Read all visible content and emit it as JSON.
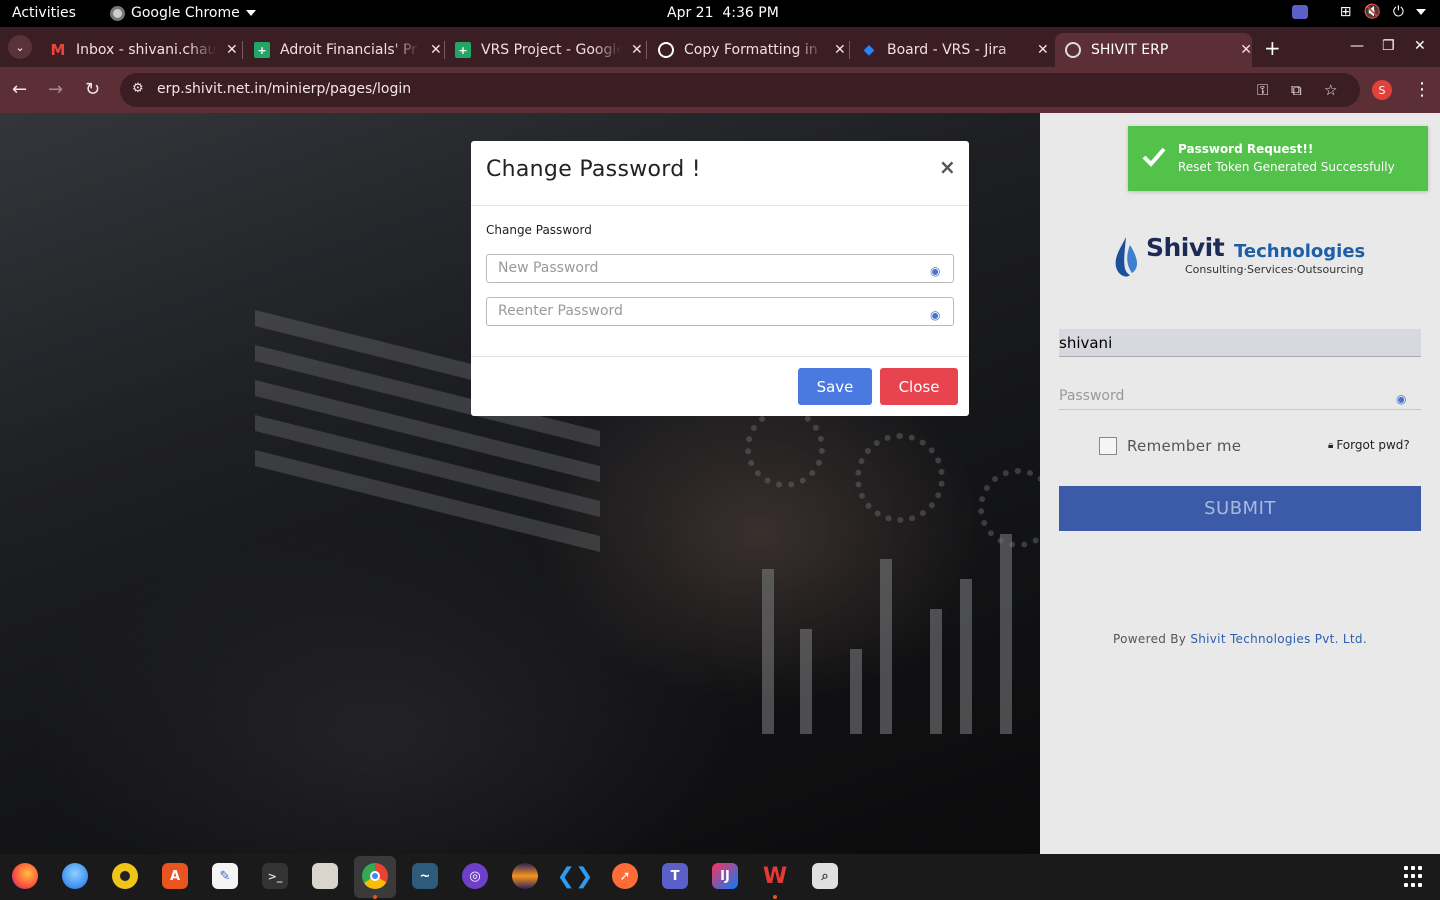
{
  "system": {
    "activities": "Activities",
    "app_name": "Google Chrome",
    "date": "Apr 21",
    "time": "4:36 PM"
  },
  "browser": {
    "tabs": [
      {
        "title": "Inbox - shivani.chau",
        "icon": "gmail-icon",
        "color": "#e8453c"
      },
      {
        "title": "Adroit Financials' Pr",
        "icon": "sheets-icon",
        "color": "#23a566"
      },
      {
        "title": "VRS Project - Google",
        "icon": "sheets-icon",
        "color": "#23a566"
      },
      {
        "title": "Copy Formatting in",
        "icon": "chatgpt-icon",
        "color": "#ffffff"
      },
      {
        "title": "Board - VRS - Jira",
        "icon": "jira-icon",
        "color": "#2684ff"
      },
      {
        "title": "SHIVIT ERP",
        "icon": "globe-icon",
        "color": "#dddddd"
      }
    ],
    "url": "erp.shivit.net.in/minierp/pages/login",
    "profile_initial": "S"
  },
  "login": {
    "brand_main": "Shivit",
    "brand_sub": "Technologies",
    "tagline": "Consulting·Services·Outsourcing",
    "username_value": "shivani",
    "password_placeholder": "Password",
    "remember_label": "Remember me",
    "forgot_label": "Forgot pwd?",
    "submit_label": "SUBMIT",
    "powered_prefix": "Powered By ",
    "powered_link": "Shivit Technologies Pvt. Ltd."
  },
  "toast": {
    "title": "Password Request!!",
    "message": "Reset Token Generated Successfully",
    "color": "#52c24a"
  },
  "modal": {
    "title": "Change Password !",
    "close_symbol": "×",
    "section_label": "Change Password",
    "new_password_placeholder": "New Password",
    "reenter_password_placeholder": "Reenter Password",
    "save_label": "Save",
    "close_label": "Close"
  },
  "dock": {
    "apps": [
      "firefox-icon",
      "thunderbird-icon",
      "rhythmbox-icon",
      "app-center-icon",
      "text-editor-icon",
      "terminal-icon",
      "files-icon",
      "chrome-icon",
      "mysql-workbench-icon",
      "github-desktop-icon",
      "eclipse-icon",
      "vscode-icon",
      "postman-icon",
      "teams-icon",
      "intellij-icon",
      "wps-office-icon",
      "image-viewer-icon"
    ]
  }
}
